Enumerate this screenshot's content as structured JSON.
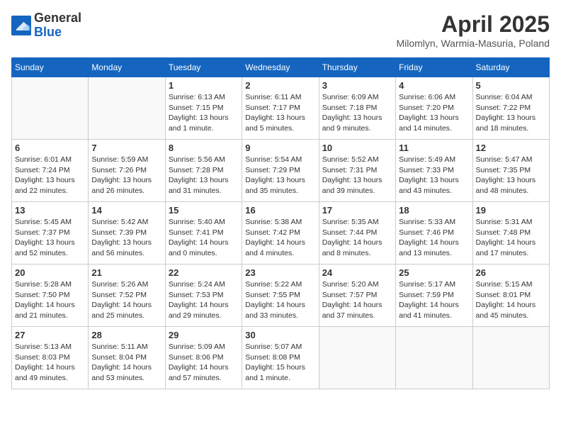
{
  "header": {
    "logo_general": "General",
    "logo_blue": "Blue",
    "month_title": "April 2025",
    "location": "Milomlyn, Warmia-Masuria, Poland"
  },
  "days_of_week": [
    "Sunday",
    "Monday",
    "Tuesday",
    "Wednesday",
    "Thursday",
    "Friday",
    "Saturday"
  ],
  "weeks": [
    [
      {
        "day": "",
        "info": ""
      },
      {
        "day": "",
        "info": ""
      },
      {
        "day": "1",
        "info": "Sunrise: 6:13 AM\nSunset: 7:15 PM\nDaylight: 13 hours and 1 minute."
      },
      {
        "day": "2",
        "info": "Sunrise: 6:11 AM\nSunset: 7:17 PM\nDaylight: 13 hours and 5 minutes."
      },
      {
        "day": "3",
        "info": "Sunrise: 6:09 AM\nSunset: 7:18 PM\nDaylight: 13 hours and 9 minutes."
      },
      {
        "day": "4",
        "info": "Sunrise: 6:06 AM\nSunset: 7:20 PM\nDaylight: 13 hours and 14 minutes."
      },
      {
        "day": "5",
        "info": "Sunrise: 6:04 AM\nSunset: 7:22 PM\nDaylight: 13 hours and 18 minutes."
      }
    ],
    [
      {
        "day": "6",
        "info": "Sunrise: 6:01 AM\nSunset: 7:24 PM\nDaylight: 13 hours and 22 minutes."
      },
      {
        "day": "7",
        "info": "Sunrise: 5:59 AM\nSunset: 7:26 PM\nDaylight: 13 hours and 26 minutes."
      },
      {
        "day": "8",
        "info": "Sunrise: 5:56 AM\nSunset: 7:28 PM\nDaylight: 13 hours and 31 minutes."
      },
      {
        "day": "9",
        "info": "Sunrise: 5:54 AM\nSunset: 7:29 PM\nDaylight: 13 hours and 35 minutes."
      },
      {
        "day": "10",
        "info": "Sunrise: 5:52 AM\nSunset: 7:31 PM\nDaylight: 13 hours and 39 minutes."
      },
      {
        "day": "11",
        "info": "Sunrise: 5:49 AM\nSunset: 7:33 PM\nDaylight: 13 hours and 43 minutes."
      },
      {
        "day": "12",
        "info": "Sunrise: 5:47 AM\nSunset: 7:35 PM\nDaylight: 13 hours and 48 minutes."
      }
    ],
    [
      {
        "day": "13",
        "info": "Sunrise: 5:45 AM\nSunset: 7:37 PM\nDaylight: 13 hours and 52 minutes."
      },
      {
        "day": "14",
        "info": "Sunrise: 5:42 AM\nSunset: 7:39 PM\nDaylight: 13 hours and 56 minutes."
      },
      {
        "day": "15",
        "info": "Sunrise: 5:40 AM\nSunset: 7:41 PM\nDaylight: 14 hours and 0 minutes."
      },
      {
        "day": "16",
        "info": "Sunrise: 5:38 AM\nSunset: 7:42 PM\nDaylight: 14 hours and 4 minutes."
      },
      {
        "day": "17",
        "info": "Sunrise: 5:35 AM\nSunset: 7:44 PM\nDaylight: 14 hours and 8 minutes."
      },
      {
        "day": "18",
        "info": "Sunrise: 5:33 AM\nSunset: 7:46 PM\nDaylight: 14 hours and 13 minutes."
      },
      {
        "day": "19",
        "info": "Sunrise: 5:31 AM\nSunset: 7:48 PM\nDaylight: 14 hours and 17 minutes."
      }
    ],
    [
      {
        "day": "20",
        "info": "Sunrise: 5:28 AM\nSunset: 7:50 PM\nDaylight: 14 hours and 21 minutes."
      },
      {
        "day": "21",
        "info": "Sunrise: 5:26 AM\nSunset: 7:52 PM\nDaylight: 14 hours and 25 minutes."
      },
      {
        "day": "22",
        "info": "Sunrise: 5:24 AM\nSunset: 7:53 PM\nDaylight: 14 hours and 29 minutes."
      },
      {
        "day": "23",
        "info": "Sunrise: 5:22 AM\nSunset: 7:55 PM\nDaylight: 14 hours and 33 minutes."
      },
      {
        "day": "24",
        "info": "Sunrise: 5:20 AM\nSunset: 7:57 PM\nDaylight: 14 hours and 37 minutes."
      },
      {
        "day": "25",
        "info": "Sunrise: 5:17 AM\nSunset: 7:59 PM\nDaylight: 14 hours and 41 minutes."
      },
      {
        "day": "26",
        "info": "Sunrise: 5:15 AM\nSunset: 8:01 PM\nDaylight: 14 hours and 45 minutes."
      }
    ],
    [
      {
        "day": "27",
        "info": "Sunrise: 5:13 AM\nSunset: 8:03 PM\nDaylight: 14 hours and 49 minutes."
      },
      {
        "day": "28",
        "info": "Sunrise: 5:11 AM\nSunset: 8:04 PM\nDaylight: 14 hours and 53 minutes."
      },
      {
        "day": "29",
        "info": "Sunrise: 5:09 AM\nSunset: 8:06 PM\nDaylight: 14 hours and 57 minutes."
      },
      {
        "day": "30",
        "info": "Sunrise: 5:07 AM\nSunset: 8:08 PM\nDaylight: 15 hours and 1 minute."
      },
      {
        "day": "",
        "info": ""
      },
      {
        "day": "",
        "info": ""
      },
      {
        "day": "",
        "info": ""
      }
    ]
  ]
}
